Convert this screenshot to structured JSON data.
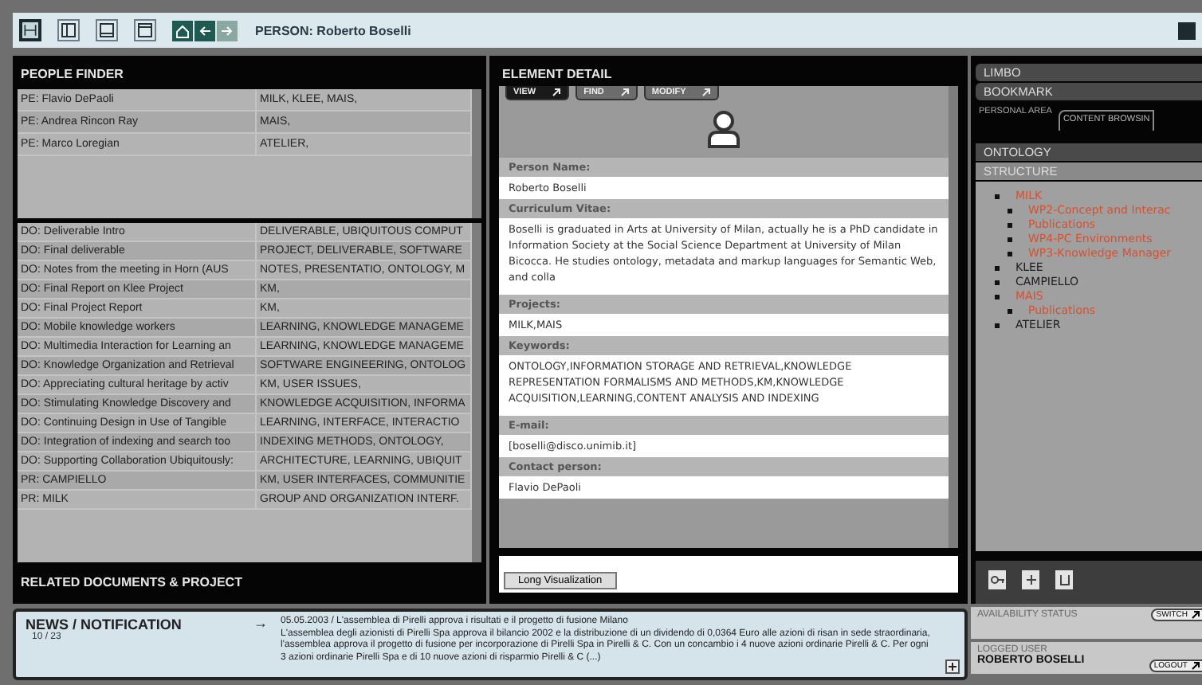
{
  "toolbar": {
    "layout_buttons": [
      {
        "kind": "split",
        "selected": true
      },
      {
        "kind": "left",
        "selected": false
      },
      {
        "kind": "bottom",
        "selected": false
      },
      {
        "kind": "frame",
        "selected": false
      }
    ],
    "nav_buttons": [
      {
        "kind": "home",
        "disabled": false
      },
      {
        "kind": "back",
        "disabled": false
      },
      {
        "kind": "forward",
        "disabled": true
      }
    ],
    "breadcrumb": "PERSON: Roberto Boselli"
  },
  "people_finder": {
    "title": "PEOPLE FINDER",
    "rows": [
      {
        "name": "PE: Flavio DePaoli",
        "projects": "MILK, KLEE, MAIS,"
      },
      {
        "name": "PE: Andrea Rincon Ray",
        "projects": "MAIS,"
      },
      {
        "name": "PE: Marco Loregian",
        "projects": "ATELIER,"
      }
    ]
  },
  "related": {
    "title": "RELATED DOCUMENTS & PROJECT",
    "rows": [
      {
        "title": "DO: Deliverable Intro",
        "keywords": "DELIVERABLE, UBIQUITOUS COMPUT"
      },
      {
        "title": "DO: Final deliverable",
        "keywords": "PROJECT, DELIVERABLE, SOFTWARE"
      },
      {
        "title": "DO: Notes from the meeting in Horn (AUS",
        "keywords": "NOTES, PRESENTATIO, ONTOLOGY, M"
      },
      {
        "title": "DO: Final Report on Klee Project",
        "keywords": "KM,"
      },
      {
        "title": "DO: Final Project Report",
        "keywords": "KM,"
      },
      {
        "title": "DO: Mobile knowledge workers",
        "keywords": "LEARNING, KNOWLEDGE MANAGEME"
      },
      {
        "title": "DO: Multimedia Interaction for Learning an",
        "keywords": "LEARNING, KNOWLEDGE MANAGEME"
      },
      {
        "title": "DO: Knowledge Organization and Retrieval",
        "keywords": "SOFTWARE ENGINEERING, ONTOLOG"
      },
      {
        "title": "DO: Appreciating cultural heritage by activ",
        "keywords": "KM, USER ISSUES,"
      },
      {
        "title": "DO: Stimulating Knowledge Discovery and",
        "keywords": "KNOWLEDGE ACQUISITION, INFORMA"
      },
      {
        "title": "DO: Continuing Design in Use of Tangible",
        "keywords": "LEARNING, INTERFACE, INTERACTIO"
      },
      {
        "title": "DO: Integration of indexing and search too",
        "keywords": "INDEXING METHODS, ONTOLOGY,"
      },
      {
        "title": "DO: Supporting Collaboration Ubiquitously:",
        "keywords": "ARCHITECTURE, LEARNING, UBIQUIT"
      },
      {
        "title": "PR: CAMPIELLO",
        "keywords": "KM, USER INTERFACES, COMMUNITIE"
      },
      {
        "title": "PR: MILK",
        "keywords": "GROUP AND ORGANIZATION INTERF."
      }
    ]
  },
  "element_detail": {
    "title": "ELEMENT DETAIL",
    "tabs": [
      {
        "label": "VIEW",
        "selected": true
      },
      {
        "label": "FIND",
        "selected": false
      },
      {
        "label": "MODIFY",
        "selected": false
      }
    ],
    "fields": [
      {
        "label": "Person Name:",
        "value": "Roberto Boselli"
      },
      {
        "label": "Curriculum Vitae:",
        "value": "Boselli is graduated in Arts at University of Milan, actually he is a PhD candidate in Information Society at the Social Science Department at University of Milan Bicocca. He studies ontology, metadata and markup languages for Semantic Web, and colla"
      },
      {
        "label": "Projects:",
        "value": "MILK,MAIS"
      },
      {
        "label": "Keywords:",
        "value": "ONTOLOGY,INFORMATION STORAGE AND RETRIEVAL,KNOWLEDGE REPRESENTATION FORMALISMS AND METHODS,KM,KNOWLEDGE ACQUISITION,LEARNING,CONTENT ANALYSIS AND INDEXING"
      },
      {
        "label": "E-mail:",
        "value": "[boselli@disco.unimib.it]"
      },
      {
        "label": "Contact person:",
        "value": "Flavio DePaoli"
      }
    ],
    "button": "Long Visualization"
  },
  "side": {
    "sections": [
      {
        "label": "LIMBO"
      },
      {
        "label": "BOOKMARK"
      }
    ],
    "area_tabs": [
      {
        "label": "PERSONAL AREA",
        "selected": false
      },
      {
        "label": "CONTENT BROWSIN",
        "selected": true
      }
    ],
    "views": [
      {
        "label": "ONTOLOGY",
        "selected": false
      },
      {
        "label": "STRUCTURE",
        "selected": true
      }
    ],
    "tree": [
      {
        "label": "MILK",
        "color": "#d9502a",
        "children": [
          {
            "label": "WP2-Concept and Interac",
            "color": "#d9502a"
          },
          {
            "label": "Publications",
            "color": "#d9502a"
          },
          {
            "label": "WP4-PC Environments",
            "color": "#d9502a"
          },
          {
            "label": "WP3-Knowledge Manager",
            "color": "#d9502a"
          }
        ]
      },
      {
        "label": "KLEE",
        "color": "#202020"
      },
      {
        "label": "CAMPIELLO",
        "color": "#202020"
      },
      {
        "label": "MAIS",
        "color": "#d9502a",
        "children": [
          {
            "label": "Publications",
            "color": "#d9502a"
          }
        ]
      },
      {
        "label": "ATELIER",
        "color": "#202020"
      }
    ],
    "tools": [
      {
        "kind": "key"
      },
      {
        "kind": "plus"
      },
      {
        "kind": "bin"
      }
    ]
  },
  "news": {
    "title": "NEWS / NOTIFICATION",
    "counter": "10 / 23",
    "arrow": "→",
    "headline": "05.05.2003 / L'assemblea di Pirelli approva i risultati e il progetto di fusione Milano",
    "body": "L'assemblea degli azionisti di Pirelli Spa approva il bilancio 2002 e la distribuzione di un dividendo di 0,0364 Euro alle azioni di risan in sede straordinaria, l'assemblea approva il progetto di fusione per incorporazione di Pirelli Spa in Pirelli & C. Con un concambio i 4 nuove azioni ordinarie Pirelli & C. Per ogni 3 azioni ordinarie Pirelli Spa e di 10 nuove azioni di risparmio Pirelli & C (...)"
  },
  "status": {
    "availability_label": "AVAILABILITY STATUS",
    "switch_button": "SWITCH",
    "user_label": "LOGGED USER",
    "user_name": "ROBERTO BOSELLI",
    "logout_button": "LOGOUT"
  }
}
